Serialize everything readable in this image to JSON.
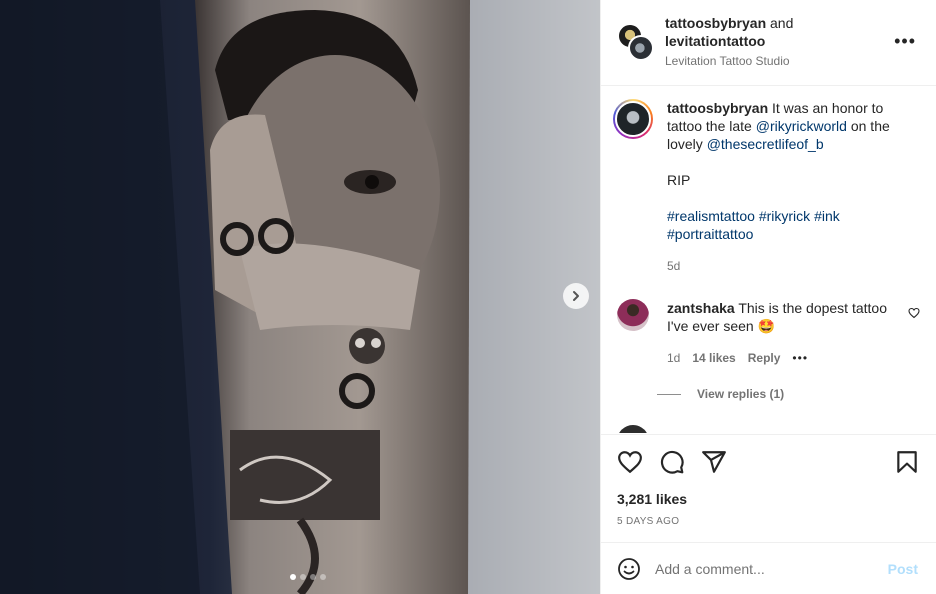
{
  "header": {
    "user1": "tattoosbybryan",
    "joiner": "and",
    "user2": "levitationtattoo",
    "location": "Levitation Tattoo Studio",
    "more_icon": "more-horizontal-icon"
  },
  "caption": {
    "username": "tattoosbybryan",
    "text_1": "It was an honor to tattoo the late",
    "mention_1": "@rikyrickworld",
    "text_2": "on the lovely",
    "mention_2": "@thesecretlifeof_b",
    "line_2": "RIP",
    "hashtags": [
      "#realismtattoo",
      "#rikyrick",
      "#ink",
      "#portraittattoo"
    ],
    "age": "5d"
  },
  "comment": {
    "username": "zantshaka",
    "text": "This is the dopest tattoo I've ever seen",
    "emoji": "🤩",
    "age": "1d",
    "likes": "14 likes",
    "reply_label": "Reply",
    "more_label": "•••",
    "view_replies": "View replies (1)"
  },
  "actions": {
    "likes": "3,281 likes",
    "posted": "5 DAYS AGO",
    "icons": [
      "heart-icon",
      "comment-icon",
      "share-icon",
      "bookmark-icon"
    ]
  },
  "add_comment": {
    "placeholder": "Add a comment...",
    "post_label": "Post",
    "emoji_icon": "emoji-icon"
  },
  "carousel": {
    "slide_count": 4,
    "active_index": 0,
    "next_icon": "chevron-right-icon"
  }
}
